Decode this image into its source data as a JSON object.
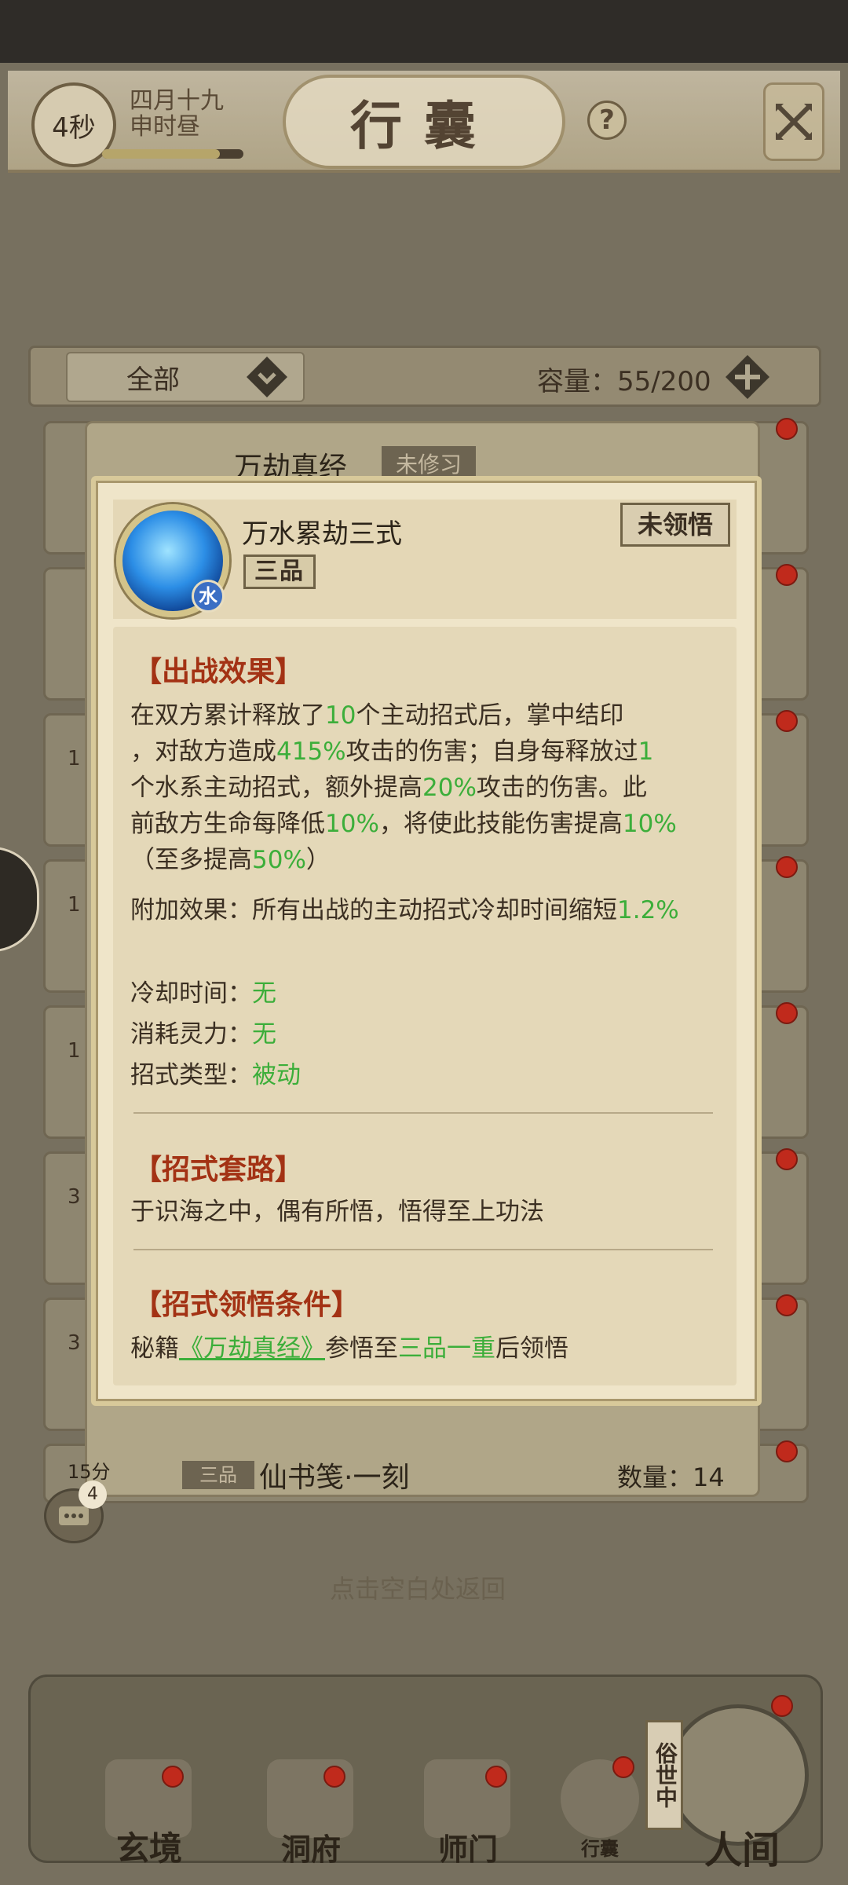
{
  "status_bar": {
    "bg": "#2f2c28"
  },
  "header": {
    "countdown": "4秒",
    "date_line1": "四月十九",
    "date_line2": "申时昼",
    "title": "行囊",
    "help_label": "?"
  },
  "filter": {
    "selected": "全部",
    "capacity_label": "容量：55/200"
  },
  "list_background": {
    "book_title": "万劫真经",
    "book_tag": "未修习",
    "row_numbers": [
      "1",
      "1",
      "1",
      "3",
      "3"
    ],
    "last_item_num": "15分",
    "last_item_grade": "三品",
    "last_item_name": "仙书笺·一刻",
    "last_item_count": "数量：14",
    "tap_hint": "点击空白处返回",
    "chat_badge": "4"
  },
  "dialog": {
    "skill_name": "万水累劫三式",
    "grade": "三品",
    "element": "水",
    "status": "未领悟",
    "section1_title": "【出战效果】",
    "effect": {
      "t1": "在双方累计释放了",
      "v1": "10",
      "t2": "个主动招式后，掌中结印",
      "t3": "，对敌方造成",
      "v2": "415%",
      "t4": "攻击的伤害；自身每释放过",
      "v3": "1",
      "t5": "个水系主动招式，额外提高",
      "v4": "20%",
      "t6": "攻击的伤害。此",
      "t7": "前敌方生命每降低",
      "v5": "10%",
      "t8": "，将使此技能伤害提高",
      "v6": "10%",
      "t9": "（至多提高",
      "v7": "50%",
      "t10": "）"
    },
    "extra": {
      "label": "附加效果：所有出战的主动招式冷却时间缩短",
      "value": "1.2%"
    },
    "cooldown": {
      "label": "冷却时间：",
      "value": "无"
    },
    "cost": {
      "label": "消耗灵力：",
      "value": "无"
    },
    "type": {
      "label": "招式类型：",
      "value": "被动"
    },
    "section2_title": "【招式套路】",
    "routine_text": "于识海之中，偶有所悟，悟得至上功法",
    "section3_title": "【招式领悟条件】",
    "cond": {
      "t1": "秘籍",
      "link": "《万劫真经》",
      "t2": "参悟至",
      "v1": "三品一重",
      "t3": "后领悟"
    }
  },
  "bottom_nav": {
    "items": [
      "玄境",
      "洞府",
      "师门",
      "行囊"
    ],
    "realm_tag": "俗世中",
    "realm_label": "人间"
  },
  "colors": {
    "accent_green": "#3cae3a",
    "section_red": "#a33214",
    "badge_red": "#c02a1c"
  }
}
